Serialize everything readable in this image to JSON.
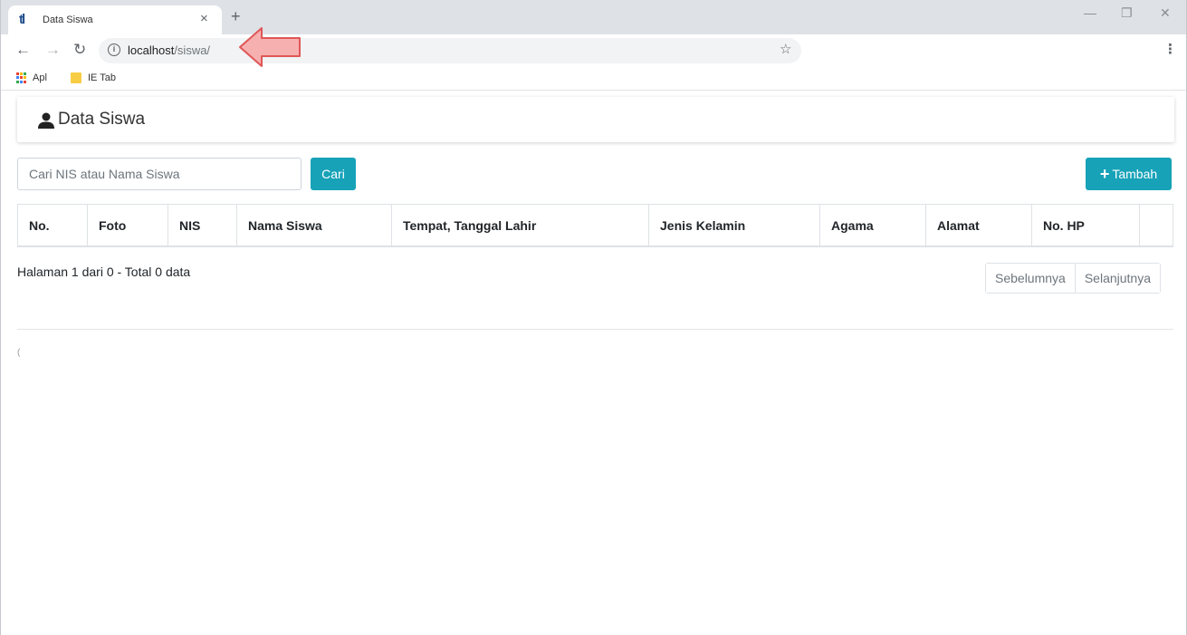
{
  "browser": {
    "tab_title": "Data Siswa",
    "tab_close": "×",
    "new_tab": "+",
    "url_host": "localhost",
    "url_path": "/siswa/",
    "favicon_text": "tl",
    "bookmarks": [
      {
        "label": "Apl",
        "icon": "apps-grid-icon"
      },
      {
        "label": "IE Tab",
        "icon": "folder-icon"
      }
    ],
    "window_controls": [
      "—",
      "❐",
      "✕"
    ]
  },
  "page": {
    "title": "Data Siswa",
    "search": {
      "placeholder": "Cari NIS atau Nama Siswa",
      "value": ""
    },
    "search_button": "Cari",
    "add_button": "Tambah",
    "table": {
      "columns": [
        "No.",
        "Foto",
        "NIS",
        "Nama Siswa",
        "Tempat, Tanggal Lahir",
        "Jenis Kelamin",
        "Agama",
        "Alamat",
        "No. HP",
        ""
      ],
      "rows": []
    },
    "page_info": "Halaman 1 dari 0 - Total 0 data",
    "pagination": {
      "prev": "Sebelumnya",
      "next": "Selanjutnya"
    },
    "footer": "("
  },
  "colors": {
    "accent": "#17a2b8",
    "annotation_arrow": "#f4a6a6"
  }
}
